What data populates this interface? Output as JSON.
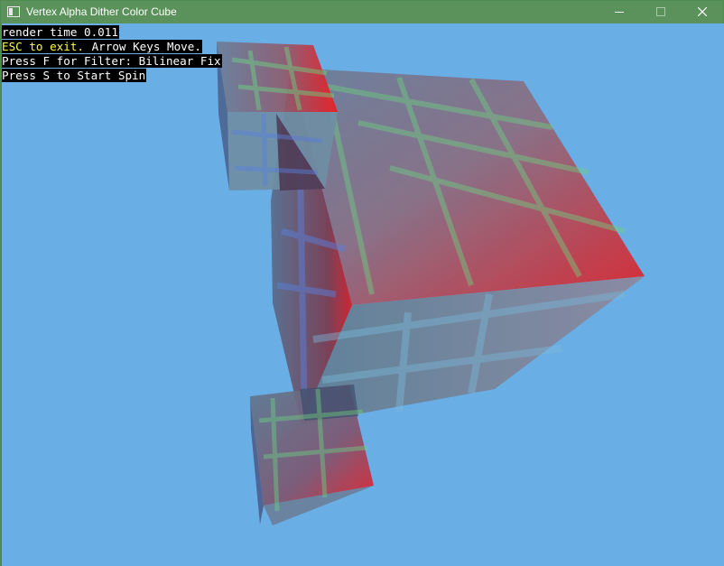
{
  "window": {
    "title": "Vertex Alpha Dither Color Cube",
    "controls": {
      "minimize_icon": "minimize-icon",
      "maximize_icon": "maximize-icon",
      "close_icon": "close-icon"
    }
  },
  "hud": {
    "render_time": "render time 0.011",
    "esc_hint": "ESC to exit.",
    "arrow_hint": " Arrow Keys Move.",
    "filter_hint": "Press F for Filter: Bilinear Fix",
    "spin_hint": "Press S to Start Spin"
  },
  "colors": {
    "background": "#6aaee6",
    "titlebar": "#5b915b",
    "hud_text": "#ffffff",
    "hud_highlight": "#ffff44"
  }
}
